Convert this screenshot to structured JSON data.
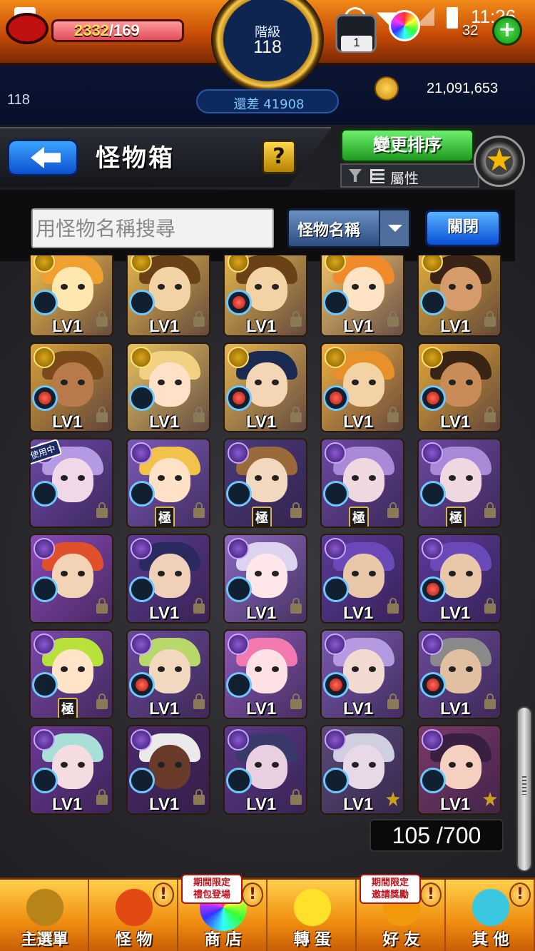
{
  "status_bar": {
    "time": "11:26"
  },
  "player": {
    "stamina_current": "2332",
    "stamina_max": "/169",
    "rank_label": "階級",
    "rank_value": "118",
    "exp_left": "118",
    "rank_diff": "還差 41908",
    "gacha_tickets": "1",
    "orbs": "32",
    "gold": "21,091,653"
  },
  "header": {
    "back_label": "",
    "title": "怪物箱",
    "help_label": "?",
    "sort_button": "變更排序",
    "sort_attribute": "屬性"
  },
  "search": {
    "placeholder": "用怪物名稱搜尋",
    "type_label": "怪物名稱",
    "close_label": "關閉"
  },
  "monsters": [
    {
      "label": "LV1",
      "badge": "lv",
      "elem": "light",
      "slot": "empty",
      "pal": [
        "#f7c24a",
        "#ffe7b0",
        "#f0a030"
      ]
    },
    {
      "label": "LV1",
      "badge": "lv",
      "elem": "light",
      "slot": "empty",
      "pal": [
        "#e9b94a",
        "#f3d3a6",
        "#6b4218"
      ]
    },
    {
      "label": "LV1",
      "badge": "lv",
      "elem": "light",
      "slot": "fruit",
      "pal": [
        "#e9b94a",
        "#f3d3a6",
        "#6b4218"
      ]
    },
    {
      "label": "LV1",
      "badge": "lv",
      "elem": "light",
      "slot": "flower",
      "pal": [
        "#f5c86a",
        "#ffe3c4",
        "#f08a2a"
      ]
    },
    {
      "label": "LV1",
      "badge": "lv",
      "elem": "light",
      "slot": "empty",
      "pal": [
        "#e5b03a",
        "#d69b6a",
        "#3a2418"
      ]
    },
    {
      "label": "LV1",
      "badge": "lv",
      "elem": "light",
      "slot": "fruit",
      "pal": [
        "#d9a23a",
        "#b87a4a",
        "#7a4a1a"
      ]
    },
    {
      "label": "LV1",
      "badge": "lv",
      "elem": "light",
      "slot": "empty",
      "pal": [
        "#e8c25e",
        "#ffe1c8",
        "#f2d282"
      ]
    },
    {
      "label": "LV1",
      "badge": "lv",
      "elem": "light",
      "slot": "fruit",
      "pal": [
        "#e6b650",
        "#f4d6b6",
        "#1a2a50"
      ]
    },
    {
      "label": "LV1",
      "badge": "lv",
      "elem": "light",
      "slot": "fruit",
      "pal": [
        "#f0b040",
        "#f3d3a6",
        "#e8902a"
      ]
    },
    {
      "label": "LV1",
      "badge": "lv",
      "elem": "light",
      "slot": "fruit",
      "pal": [
        "#e2a838",
        "#c98c58",
        "#3a2414"
      ]
    },
    {
      "label": "",
      "badge": "inuse",
      "elem": "dark",
      "slot": "empty",
      "pal": [
        "#6b4aa8",
        "#f0d8e8",
        "#b49ae2"
      ]
    },
    {
      "label": "極",
      "badge": "kyoku",
      "elem": "dark",
      "slot": "empty",
      "pal": [
        "#7a5ab8",
        "#ffe1c8",
        "#f2c24a"
      ]
    },
    {
      "label": "極",
      "badge": "kyoku",
      "elem": "dark",
      "slot": "empty",
      "pal": [
        "#4a3a7a",
        "#f3d8c0",
        "#9a6a3a"
      ]
    },
    {
      "label": "極",
      "badge": "kyoku",
      "elem": "dark",
      "slot": "empty",
      "pal": [
        "#6a4aa0",
        "#f0d8e0",
        "#a88ad8"
      ]
    },
    {
      "label": "極",
      "badge": "kyoku",
      "elem": "dark",
      "slot": "empty",
      "pal": [
        "#6a4aa0",
        "#f0d8e0",
        "#a88ad8"
      ]
    },
    {
      "label": "",
      "badge": "none",
      "elem": "dark",
      "slot": "empty",
      "pal": [
        "#8a4ab8",
        "#f3d3b6",
        "#e0502a"
      ]
    },
    {
      "label": "LV1",
      "badge": "lv",
      "elem": "dark",
      "slot": "empty",
      "pal": [
        "#5a3a90",
        "#f0d0b8",
        "#2a2a60"
      ]
    },
    {
      "label": "LV1",
      "badge": "lv",
      "elem": "dark",
      "slot": "empty",
      "pal": [
        "#8a6ac0",
        "#ffe6ea",
        "#dcd4ee"
      ]
    },
    {
      "label": "LV1",
      "badge": "lv",
      "elem": "dark",
      "slot": "empty",
      "pal": [
        "#5a3a9a",
        "#e8c8a8",
        "#6a4ab8"
      ]
    },
    {
      "label": "LV1",
      "badge": "lv",
      "elem": "dark",
      "slot": "fruit",
      "pal": [
        "#5a3a9a",
        "#e8c8a8",
        "#6a4ab8"
      ]
    },
    {
      "label": "極",
      "badge": "kyoku",
      "elem": "dark",
      "slot": "empty",
      "pal": [
        "#7a4aaa",
        "#ffe4c8",
        "#b8e23a"
      ]
    },
    {
      "label": "LV1",
      "badge": "lv",
      "elem": "dark",
      "slot": "fruit",
      "pal": [
        "#6a4a9a",
        "#f3d8c0",
        "#b8d86a"
      ]
    },
    {
      "label": "LV1",
      "badge": "lv",
      "elem": "dark",
      "slot": "empty",
      "pal": [
        "#8a5ab8",
        "#ffe0e4",
        "#f27ab0"
      ]
    },
    {
      "label": "LV1",
      "badge": "lv",
      "elem": "dark",
      "slot": "fruit",
      "pal": [
        "#7a5ab0",
        "#f3dad0",
        "#b49ae0"
      ]
    },
    {
      "label": "LV1",
      "badge": "lv",
      "elem": "dark",
      "slot": "fruit",
      "pal": [
        "#6a4a9a",
        "#e0c0a0",
        "#8a8a8a"
      ]
    },
    {
      "label": "LV1",
      "badge": "lv",
      "elem": "dark",
      "slot": "empty",
      "pal": [
        "#6a3a98",
        "#f3dde0",
        "#a8e0d8"
      ]
    },
    {
      "label": "LV1",
      "badge": "lv",
      "elem": "dark",
      "slot": "empty",
      "pal": [
        "#4a2a6a",
        "#6a3a2a",
        "#eaeaea"
      ]
    },
    {
      "label": "LV1",
      "badge": "lv",
      "elem": "dark",
      "slot": "empty",
      "pal": [
        "#5a3a8a",
        "#e8d0e0",
        "#3a3a6a"
      ]
    },
    {
      "label": "LV1",
      "badge": "star",
      "elem": "dark",
      "slot": "empty",
      "pal": [
        "#5a4a7a",
        "#e8d8e8",
        "#cfcfe0"
      ]
    },
    {
      "label": "LV1",
      "badge": "star",
      "elem": "dark",
      "slot": "empty",
      "pal": [
        "#7a3a6a",
        "#f5d0c0",
        "#3a2040"
      ]
    }
  ],
  "box_count": "105 /700",
  "nav": [
    {
      "label": "主選單",
      "badge": "",
      "promo": "",
      "icon": "gate-icon",
      "color": "#b8841a"
    },
    {
      "label": "怪 物",
      "badge": "!",
      "promo": "",
      "icon": "dragon-icon",
      "color": "#e24a14"
    },
    {
      "label": "商 店",
      "badge": "!",
      "promo": "期間限定\n禮包登場",
      "icon": "orb-icon",
      "color": "#c060ff"
    },
    {
      "label": "轉 蛋",
      "badge": "",
      "promo": "",
      "icon": "egg-icon",
      "color": "#ffe02a"
    },
    {
      "label": "好 友",
      "badge": "!",
      "promo": "期間限定\n邀請獎勵",
      "icon": "friends-icon",
      "color": "#f29a0c"
    },
    {
      "label": "其 他",
      "badge": "!",
      "promo": "",
      "icon": "question-icon",
      "color": "#3ac8e0"
    }
  ]
}
